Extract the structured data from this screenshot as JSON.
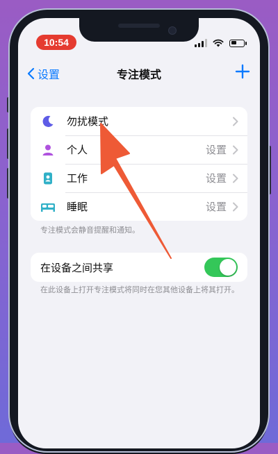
{
  "status_bar": {
    "time": "10:54"
  },
  "nav": {
    "back_label": "设置",
    "title": "专注模式"
  },
  "focus_modes": [
    {
      "label": "勿扰模式",
      "value": "",
      "icon": "moon-icon"
    },
    {
      "label": "个人",
      "value": "设置",
      "icon": "person-icon"
    },
    {
      "label": "工作",
      "value": "设置",
      "icon": "id-badge-icon"
    },
    {
      "label": "睡眠",
      "value": "设置",
      "icon": "bed-icon"
    }
  ],
  "focus_footnote": "专注模式会静音提醒和通知。",
  "share": {
    "label": "在设备之间共享",
    "enabled": true,
    "footnote": "在此设备上打开专注模式将同时在您其他设备上将其打开。"
  },
  "colors": {
    "accent": "#0a7aff",
    "toggle_on": "#34c759",
    "time_pill": "#e53b30",
    "moon": "#5e5ce6",
    "person": "#af52de",
    "work": "#30b0c7",
    "sleep": "#30b0c7",
    "annotation_arrow": "#ee5a36"
  }
}
